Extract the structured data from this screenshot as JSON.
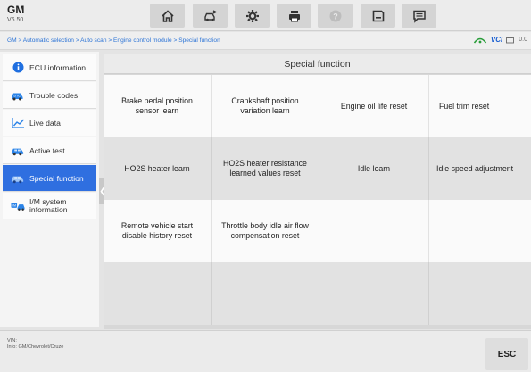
{
  "header": {
    "make": "GM",
    "version": "V6.50",
    "toolbar": [
      {
        "name": "home-button",
        "icon": "home-icon"
      },
      {
        "name": "vehicle-swap-button",
        "icon": "vehicle-swap-icon"
      },
      {
        "name": "settings-button",
        "icon": "gear-icon"
      },
      {
        "name": "print-button",
        "icon": "printer-icon"
      },
      {
        "name": "help-button",
        "icon": "help-icon"
      },
      {
        "name": "save-button",
        "icon": "save-icon"
      },
      {
        "name": "data-logging-button",
        "icon": "message-icon"
      }
    ]
  },
  "breadcrumb": {
    "items": [
      "GM",
      "Automatic selection",
      "Auto scan",
      "Engine control module",
      "Special function"
    ],
    "separator": ">"
  },
  "status": {
    "vci_label": "VCI",
    "battery_label": "0.0"
  },
  "sidebar": {
    "items": [
      {
        "label": "ECU information",
        "icon": "info-icon"
      },
      {
        "label": "Trouble codes",
        "icon": "trouble-codes-icon"
      },
      {
        "label": "Live data",
        "icon": "live-data-chart-icon"
      },
      {
        "label": "Active test",
        "icon": "active-test-car-icon"
      },
      {
        "label": "Special function",
        "icon": "special-function-car-icon",
        "active": true
      },
      {
        "label": "I/M system information",
        "label_line1": "I/M system",
        "label_line2": "information",
        "icon": "im-system-icon"
      }
    ]
  },
  "main": {
    "title": "Special function",
    "functions": [
      "Brake pedal position sensor learn",
      "Crankshaft position variation learn",
      "Engine oil life reset",
      "Fuel trim reset",
      "HO2S heater learn",
      "HO2S heater resistance learned values reset",
      "Idle learn",
      "Idle speed adjustment",
      "Remote vehicle start disable history reset",
      "Throttle body idle air flow compensation reset"
    ]
  },
  "footer": {
    "vin_label": "VIN:",
    "info_label": "Info: GM/Chevrolet/Cruze",
    "esc_label": "ESC"
  },
  "colors": {
    "accent": "#2f6fe0",
    "link": "#2b73d6",
    "vci": "#1a5fd1"
  }
}
